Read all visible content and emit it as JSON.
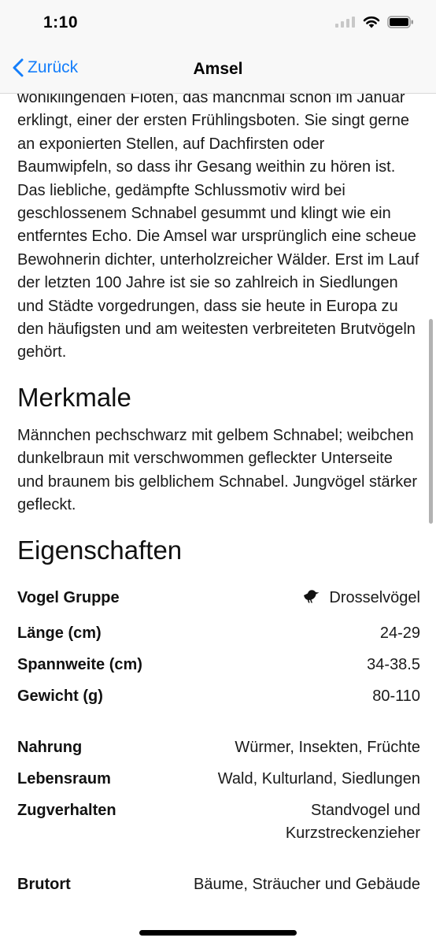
{
  "status_bar": {
    "time": "1:10"
  },
  "nav": {
    "back_label": "Zurück",
    "title": "Amsel"
  },
  "intro_text": "wohlklingenden Flöten, das manchmal schon im Januar erklingt, einer der ersten Frühlingsboten. Sie singt gerne an exponierten Stellen, auf Dachfirsten oder Baumwipfeln, so dass ihr Gesang weithin zu hören ist. Das liebliche, gedämpfte Schlussmotiv wird bei geschlossenem Schnabel gesummt und klingt wie ein entferntes Echo. Die Amsel war ursprünglich eine scheue Bewohnerin dichter, unterholzreicher Wälder. Erst im Lauf der letzten 100 Jahre ist sie so zahlreich in Siedlungen und Städte vorgedrungen, dass sie heute in Europa zu den häufigsten und am weitesten verbreiteten Brutvögeln gehört.",
  "merkmale": {
    "heading": "Merkmale",
    "text": "Männchen pechschwarz mit gelbem Schnabel; weibchen dunkelbraun mit verschwommen gefleckter Unterseite und braunem bis gelblichem Schnabel. Jungvögel stärker gefleckt."
  },
  "eigenschaften": {
    "heading": "Eigenschaften",
    "group1": [
      {
        "label": "Vogel Gruppe",
        "value": "Drosselvögel",
        "icon": "bird-icon"
      },
      {
        "label": "Länge (cm)",
        "value": "24-29"
      },
      {
        "label": "Spannweite (cm)",
        "value": "34-38.5"
      },
      {
        "label": "Gewicht (g)",
        "value": "80-110"
      }
    ],
    "group2": [
      {
        "label": "Nahrung",
        "value": "Würmer, Insekten, Früchte"
      },
      {
        "label": "Lebensraum",
        "value": "Wald, Kulturland, Siedlungen"
      },
      {
        "label": "Zugverhalten",
        "value": "Standvogel und Kurzstreckenzieher"
      }
    ],
    "group3": [
      {
        "label": "Brutort",
        "value": "Bäume, Sträucher und Gebäude"
      }
    ]
  },
  "colors": {
    "accent": "#147efb",
    "bars": "#f8f8f8"
  }
}
